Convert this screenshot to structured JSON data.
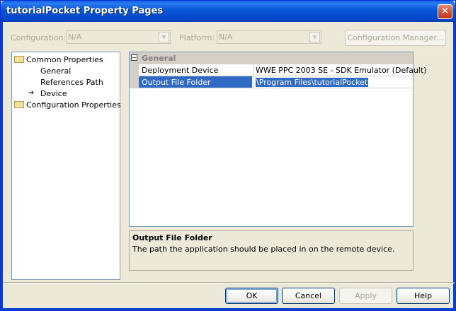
{
  "window": {
    "title": "tutorialPocket Property Pages",
    "close_glyph": "✕"
  },
  "toolbar": {
    "configuration_label": "Configuration:",
    "configuration_value": "N/A",
    "platform_label": "Platform:",
    "platform_value": "N/A",
    "config_manager_label": "Configuration Manager..."
  },
  "tree": {
    "common_properties": "Common Properties",
    "general": "General",
    "references_path": "References Path",
    "device": "Device",
    "configuration_properties": "Configuration Properties"
  },
  "grid": {
    "category": "General",
    "category_toggle": "−",
    "rows": [
      {
        "name": "Deployment Device",
        "value": "WWE PPC 2003 SE - SDK Emulator (Default)"
      },
      {
        "name": "Output File Folder",
        "value": "\\Program Files\\tutorialPocket"
      }
    ]
  },
  "description": {
    "title": "Output File Folder",
    "text": "The path the application should be placed in on the remote device."
  },
  "buttons": {
    "ok": "OK",
    "cancel": "Cancel",
    "apply": "Apply",
    "help": "Help"
  },
  "colors": {
    "title_bar": "#0a59d8",
    "selection": "#316ac5",
    "dialog_bg": "#ece9d8"
  }
}
